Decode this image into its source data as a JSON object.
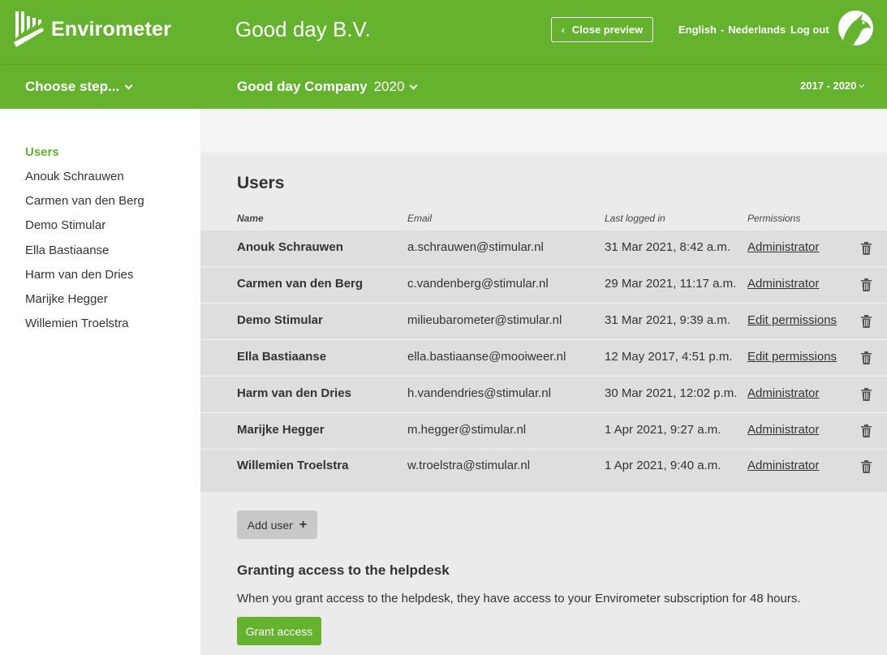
{
  "header": {
    "brand": "Envirometer",
    "company_title": "Good day B.V.",
    "close_preview": "Close preview",
    "lang_english": "English",
    "lang_separator": "-",
    "lang_dutch": "Nederlands",
    "logout": "Log out",
    "accent_color": "#64b22e"
  },
  "subbar": {
    "choose_step": "Choose step...",
    "company_name": "Good day Company",
    "company_year": "2020",
    "period": "2017 - 2020"
  },
  "sidebar": {
    "items": [
      {
        "label": "Users",
        "active": true
      },
      {
        "label": "Anouk Schrauwen"
      },
      {
        "label": "Carmen van den Berg"
      },
      {
        "label": "Demo Stimular"
      },
      {
        "label": "Ella Bastiaanse"
      },
      {
        "label": "Harm van den Dries"
      },
      {
        "label": "Marijke Hegger"
      },
      {
        "label": "Willemien Troelstra"
      }
    ]
  },
  "users": {
    "title": "Users",
    "columns": {
      "name": "Name",
      "email": "Email",
      "last_logged_in": "Last logged in",
      "permissions": "Permissions"
    },
    "rows": [
      {
        "name": "Anouk Schrauwen",
        "email": "a.schrauwen@stimular.nl",
        "last": "31 Mar 2021, 8:42 a.m.",
        "permission": "Administrator",
        "action_icon": "trash-icon"
      },
      {
        "name": "Carmen van den Berg",
        "email": "c.vandenberg@stimular.nl",
        "last": "29 Mar 2021, 11:17 a.m.",
        "permission": "Administrator",
        "action_icon": "trash-icon"
      },
      {
        "name": "Demo Stimular",
        "email": "milieubarometer@stimular.nl",
        "last": "31 Mar 2021, 9:39 a.m.",
        "permission": "Edit permissions",
        "action_icon": "trash-icon"
      },
      {
        "name": "Ella Bastiaanse",
        "email": "ella.bastiaanse@mooiweer.nl",
        "last": "12 May 2017, 4:51 p.m.",
        "permission": "Edit permissions",
        "action_icon": "trash-icon"
      },
      {
        "name": "Harm van den Dries",
        "email": "h.vandendries@stimular.nl",
        "last": "30 Mar 2021, 12:02 p.m.",
        "permission": "Administrator",
        "action_icon": "trash-icon"
      },
      {
        "name": "Marijke Hegger",
        "email": "m.hegger@stimular.nl",
        "last": "1 Apr 2021, 9:27 a.m.",
        "permission": "Administrator",
        "action_icon": "trash-icon"
      },
      {
        "name": "Willemien Troelstra",
        "email": "w.troelstra@stimular.nl",
        "last": "1 Apr 2021, 9:40 a.m.",
        "permission": "Administrator",
        "action_icon": "trash-icon"
      }
    ],
    "add_user": "Add user",
    "add_icon": "+"
  },
  "helpdesk": {
    "title": "Granting access to the helpdesk",
    "text": "When you grant access to the helpdesk, they have access to your Envirometer subscription for 48 hours.",
    "button": "Grant access"
  }
}
